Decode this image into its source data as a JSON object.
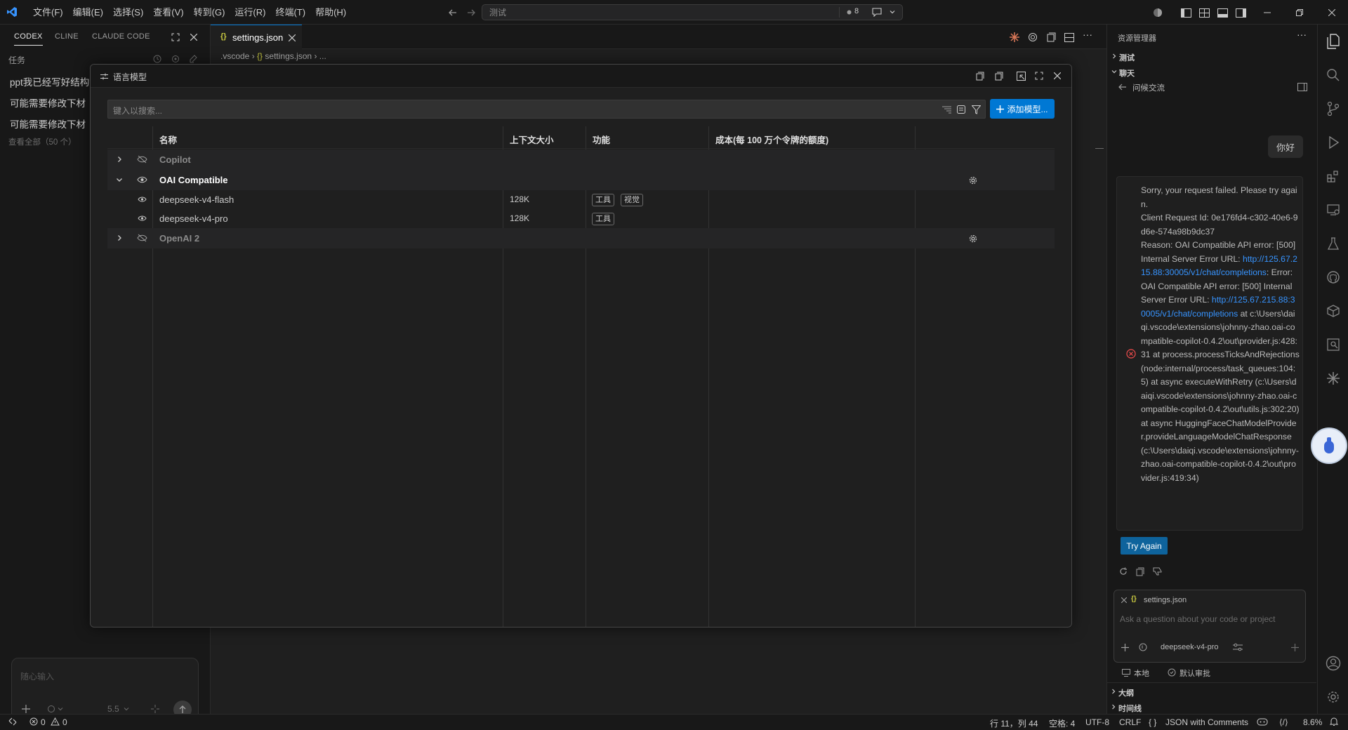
{
  "titlebar": {
    "menu": [
      "文件(F)",
      "编辑(E)",
      "选择(S)",
      "查看(V)",
      "转到(G)",
      "运行(R)",
      "终端(T)",
      "帮助(H)"
    ],
    "search_text": "测试",
    "counter": "8"
  },
  "left": {
    "tabs": [
      "CODEX",
      "CLINE",
      "CLAUDE CODE"
    ],
    "section": "任务",
    "tasks": [
      "ppt我已经写好结构",
      "可能需要修改下材",
      "可能需要修改下材"
    ],
    "view_all": "查看全部（50 个）",
    "input_placeholder": "随心输入",
    "model_short": "5.5"
  },
  "editor": {
    "tab_label": "settings.json",
    "breadcrumb_1": ".vscode",
    "breadcrumb_2": "settings.json",
    "breadcrumb_3": "..."
  },
  "modal": {
    "title": "语言模型",
    "search_placeholder": "键入以搜索...",
    "add_label": "添加模型...",
    "columns": [
      "名称",
      "上下文大小",
      "功能",
      "成本(每 100 万个令牌的额度)"
    ],
    "groups": [
      {
        "name": "Copilot"
      },
      {
        "name": "OAI Compatible"
      },
      {
        "name": "OpenAI 2"
      }
    ],
    "models": [
      {
        "name": "deepseek-v4-flash",
        "context": "128K",
        "caps": [
          "工具",
          "视觉"
        ]
      },
      {
        "name": "deepseek-v4-pro",
        "context": "128K",
        "caps": [
          "工具"
        ]
      }
    ]
  },
  "chat": {
    "explorer_title": "资源管理器",
    "tree_1": "测试",
    "tree_2": "聊天",
    "back_label": "问候交流",
    "user_msg": "你好",
    "error_lines": [
      "Sorry, your request failed. Please try again.",
      "Client Request Id: 0e176fd4-c302-40e6-9d6e-574a98b9dc37",
      "Reason: OAI Compatible API error: [500] Internal Server Error URL:"
    ],
    "link_1": "http://125.67.215.88:30005/v1/chat/completions",
    "error_mid": ": Error: OAI Compatible API error: [500] Internal Server Error URL:",
    "link_2": "http://125.67.215.88:30005/v1/chat/completions",
    "error_tail": " at c:\\Users\\daiqi.vscode\\extensions\\johnny-zhao.oai-compatible-copilot-0.4.2\\out\\provider.js:428:31 at process.processTicksAndRejections (node:internal/process/task_queues:104:5) at async executeWithRetry (c:\\Users\\daiqi.vscode\\extensions\\johnny-zhao.oai-compatible-copilot-0.4.2\\out\\utils.js:302:20) at async HuggingFaceChatModelProvider.provideLanguageModelChatResponse (c:\\Users\\daiqi.vscode\\extensions\\johnny-zhao.oai-compatible-copilot-0.4.2\\out\\provider.js:419:34)",
    "try_again": "Try Again",
    "attachment": "settings.json",
    "input_placeholder": "Ask a question about your code or project",
    "model": "deepseek-v4-pro",
    "local": "本地",
    "approval": "默认审批",
    "outline": "大纲",
    "timeline": "时间线"
  },
  "status": {
    "errors": "0",
    "warnings": "0",
    "position": "行 11，列 44",
    "spaces": "空格: 4",
    "encoding": "UTF-8",
    "eol": "CRLF",
    "language": "JSON with Comments",
    "percent": "8.6%"
  },
  "colors": {
    "accent": "#0078d4",
    "error": "#f14c4c",
    "link": "#3794ff"
  }
}
